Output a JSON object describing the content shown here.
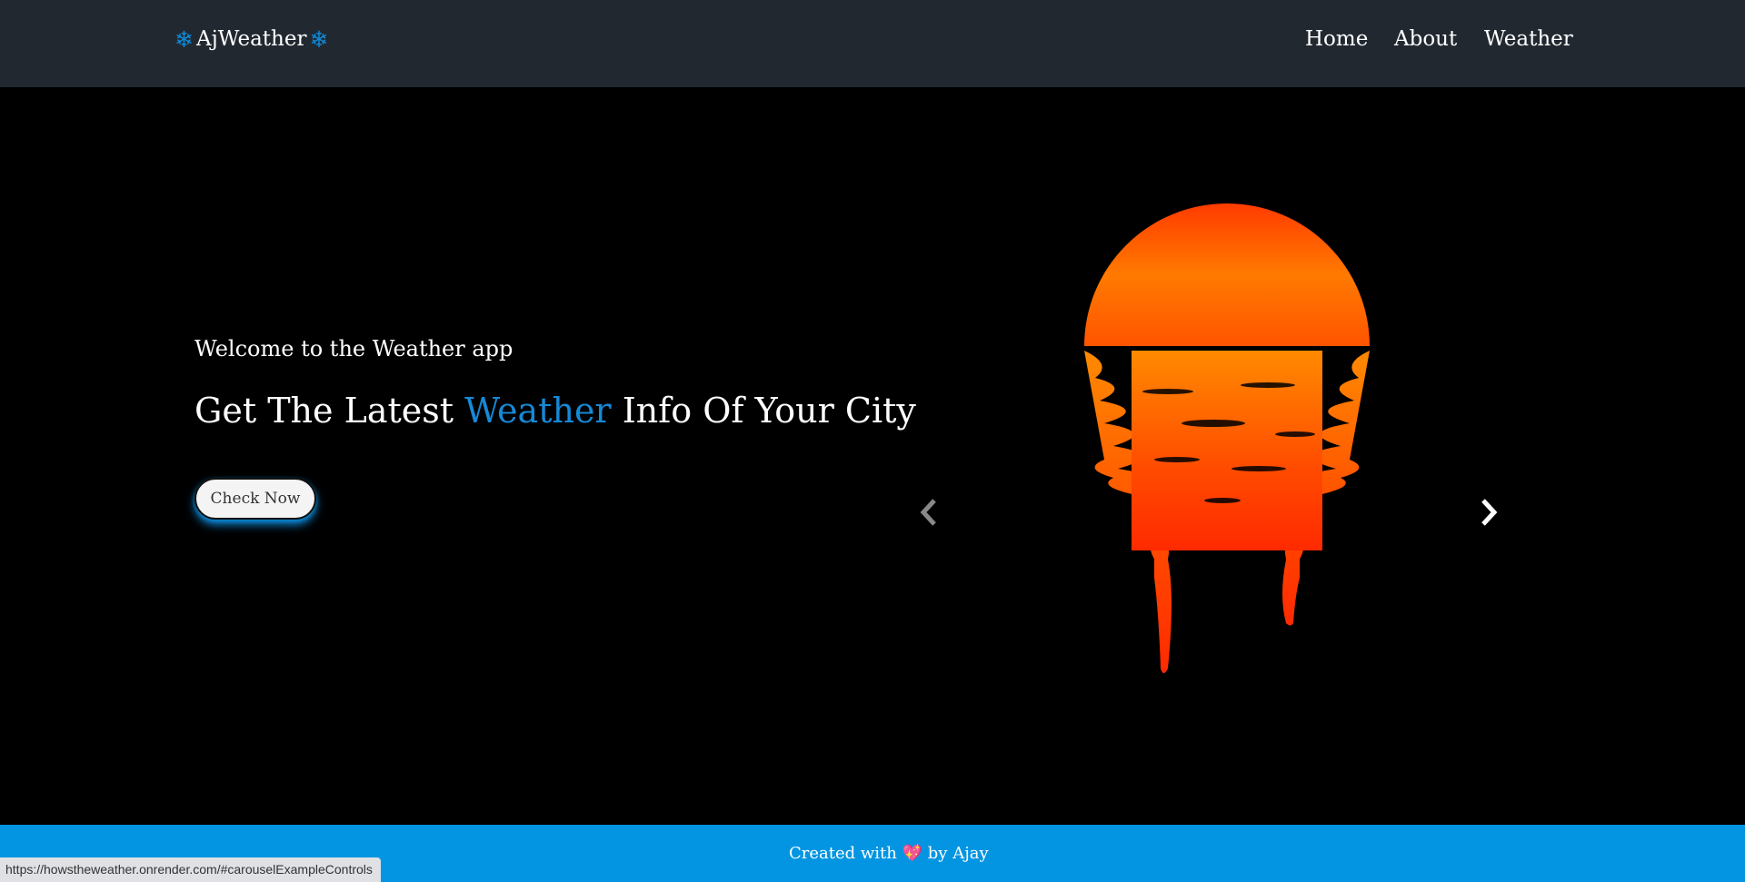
{
  "brand": {
    "name": "AjWeather",
    "icon": "snowflake-icon"
  },
  "nav": {
    "items": [
      "Home",
      "About",
      "Weather"
    ]
  },
  "hero": {
    "welcome": "Welcome to the Weather app",
    "headline_pre": "Get The Latest",
    "headline_accent": "Weather",
    "headline_post": "Info Of Your City",
    "cta_label": "Check Now",
    "prev_icon": "chevron-left-icon",
    "next_icon": "chevron-right-icon"
  },
  "footer": {
    "pre": "Created with",
    "heart": "💖",
    "post": "by Ajay"
  },
  "status": {
    "url": "https://howstheweather.onrender.com/#carouselExampleControls"
  },
  "colors": {
    "accent": "#1689d6",
    "nav_bg": "#212830",
    "footer_bg": "#0495e2",
    "hero_bg": "#000000"
  }
}
